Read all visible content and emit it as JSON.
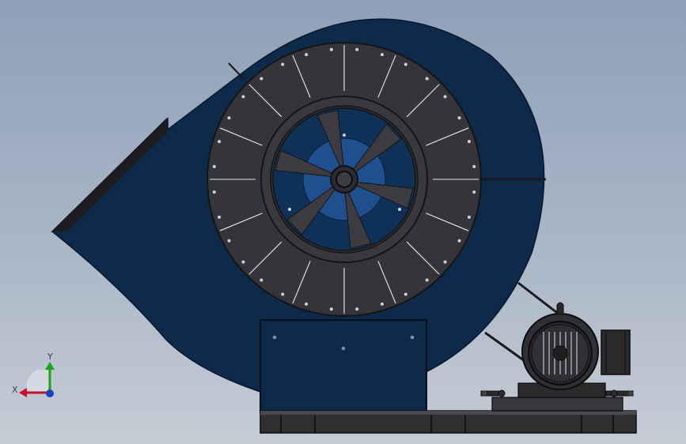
{
  "viewport": {
    "background_top": "#8ea0b8",
    "background_bottom": "#c6ccd6"
  },
  "model": {
    "housing_color": "#0d2a4a",
    "impeller_color": "#353539",
    "blade_color": "#3c3c40",
    "hub_color": "#1f4f8f",
    "base_color": "#303033",
    "motor_color": "#2f3033"
  },
  "triad": {
    "x_label": "X",
    "y_label": "Y",
    "x_color": "#c8102e",
    "y_color": "#1aa31a",
    "z_color": "#1f3fbf"
  }
}
